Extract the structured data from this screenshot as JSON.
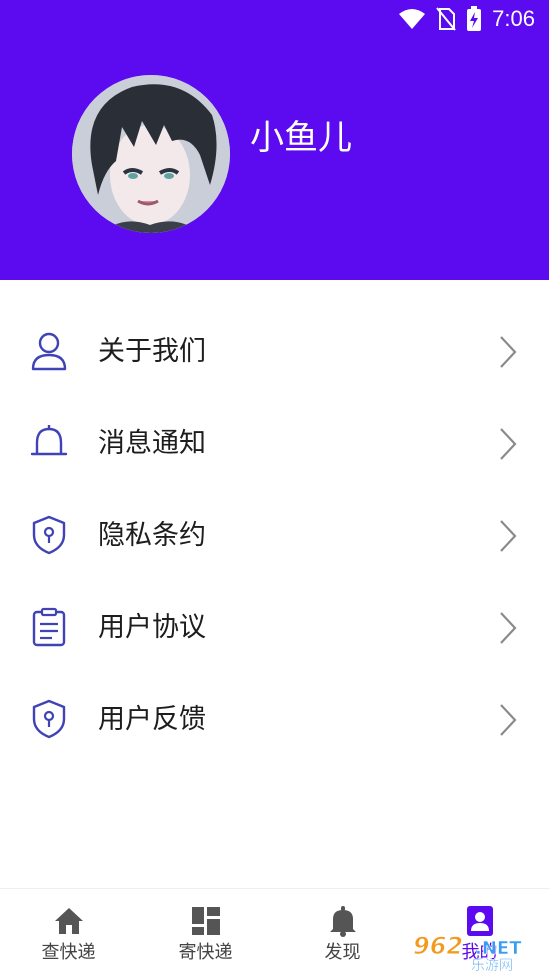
{
  "status_bar": {
    "time": "7:06",
    "icons": [
      "wifi-icon",
      "no-sim-icon",
      "battery-charging-icon"
    ]
  },
  "profile": {
    "username": "小鱼儿",
    "avatar": "avatar-image"
  },
  "menu": {
    "items": [
      {
        "label": "关于我们",
        "icon": "user-icon"
      },
      {
        "label": "消息通知",
        "icon": "bell-icon"
      },
      {
        "label": "隐私条约",
        "icon": "shield-icon"
      },
      {
        "label": "用户协议",
        "icon": "clipboard-icon"
      },
      {
        "label": "用户反馈",
        "icon": "shield-icon"
      }
    ]
  },
  "tabbar": {
    "tabs": [
      {
        "label": "查快递",
        "icon": "home-icon"
      },
      {
        "label": "寄快递",
        "icon": "grid-icon"
      },
      {
        "label": "发现",
        "icon": "bell-icon"
      },
      {
        "label": "我的",
        "icon": "profile-icon",
        "active": true
      }
    ]
  },
  "watermark": {
    "text": "962.NET 乐游网"
  },
  "colors": {
    "header": "#5c0af0",
    "icon_stroke": "#3f43b5",
    "text": "#1d1d1d",
    "chevron": "#8a8a8a",
    "tab_icon": "#555555",
    "tab_active": "#5c0af0"
  }
}
